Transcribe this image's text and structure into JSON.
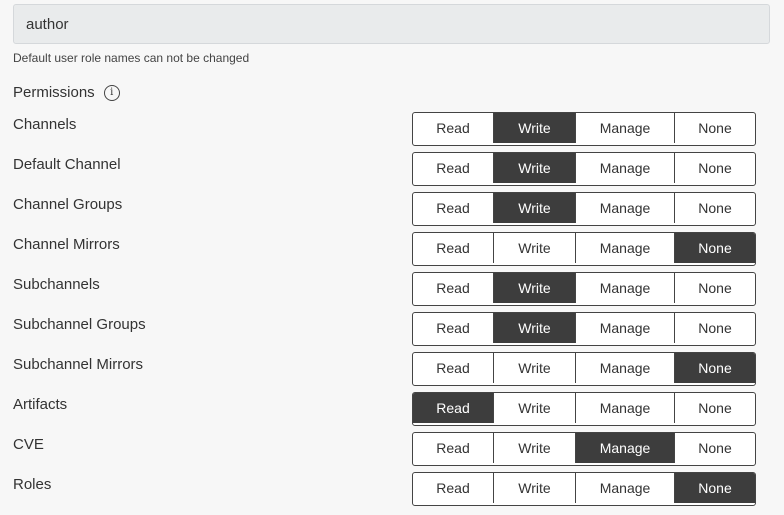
{
  "role": {
    "name_value": "author",
    "hint": "Default user role names can not be changed"
  },
  "permissions": {
    "heading": "Permissions",
    "info_icon": "info-circle-icon",
    "options": [
      "Read",
      "Write",
      "Manage",
      "None"
    ],
    "rows": [
      {
        "label": "Channels",
        "selected": "Write"
      },
      {
        "label": "Default Channel",
        "selected": "Write"
      },
      {
        "label": "Channel Groups",
        "selected": "Write"
      },
      {
        "label": "Channel Mirrors",
        "selected": "None"
      },
      {
        "label": "Subchannels",
        "selected": "Write"
      },
      {
        "label": "Subchannel Groups",
        "selected": "Write"
      },
      {
        "label": "Subchannel Mirrors",
        "selected": "None"
      },
      {
        "label": "Artifacts",
        "selected": "Read"
      },
      {
        "label": "CVE",
        "selected": "Manage"
      },
      {
        "label": "Roles",
        "selected": "None"
      }
    ]
  },
  "colors": {
    "active_bg": "#3d3d3d",
    "active_text": "#ffffff",
    "border": "#444444",
    "input_bg": "#e9ebec"
  }
}
